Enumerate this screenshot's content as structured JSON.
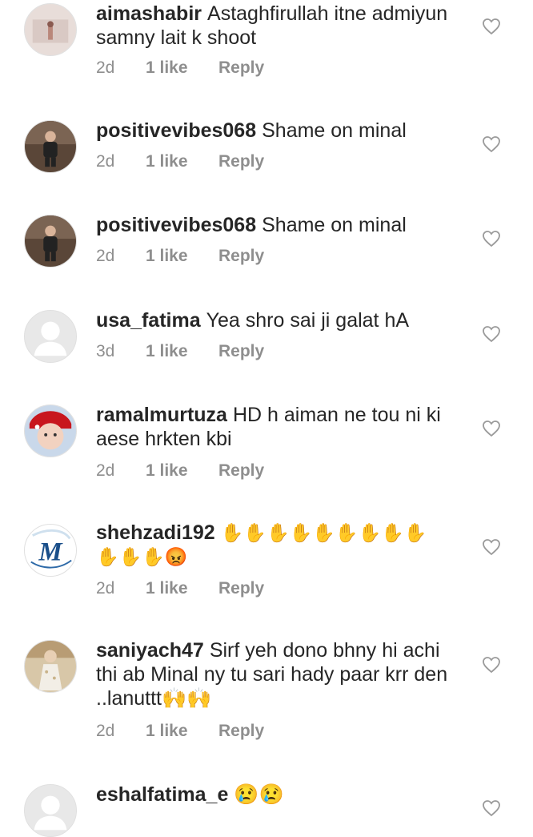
{
  "comments": [
    {
      "username": "aimashabir",
      "text": "Astaghfirullah itne admiyun samny lait k shoot",
      "age": "2d",
      "likes": "1 like",
      "reply": "Reply",
      "avatar": "photo-portrait"
    },
    {
      "username": "positivevibes068",
      "text": "Shame on minal",
      "age": "2d",
      "likes": "1 like",
      "reply": "Reply",
      "avatar": "photo-child"
    },
    {
      "username": "positivevibes068",
      "text": "Shame on minal",
      "age": "2d",
      "likes": "1 like",
      "reply": "Reply",
      "avatar": "photo-child"
    },
    {
      "username": "usa_fatima",
      "text": "Yea shro sai ji galat hA",
      "age": "3d",
      "likes": "1 like",
      "reply": "Reply",
      "avatar": "default-avatar"
    },
    {
      "username": "ramalmurtuza",
      "text": "HD h aiman ne tou ni ki aese hrkten kbi",
      "age": "2d",
      "likes": "1 like",
      "reply": "Reply",
      "avatar": "photo-girl"
    },
    {
      "username": "shehzadi192",
      "text": "✋✋✋✋✋✋✋✋✋✋✋✋😡",
      "age": "2d",
      "likes": "1 like",
      "reply": "Reply",
      "avatar": "logo-m"
    },
    {
      "username": "saniyach47",
      "text": "Sirf yeh dono bhny hi achi thi ab Minal ny tu sari hady paar krr den ..lanuttt🙌🙌",
      "age": "2d",
      "likes": "1 like",
      "reply": "Reply",
      "avatar": "photo-dress"
    },
    {
      "username": "eshalfatima_e",
      "text": "😢😢",
      "age": "",
      "likes": "",
      "reply": "",
      "avatar": "default-avatar"
    }
  ],
  "icons": {
    "like": "heart-outline-icon"
  },
  "colors": {
    "meta": "#8e8e8e",
    "text": "#262626"
  }
}
